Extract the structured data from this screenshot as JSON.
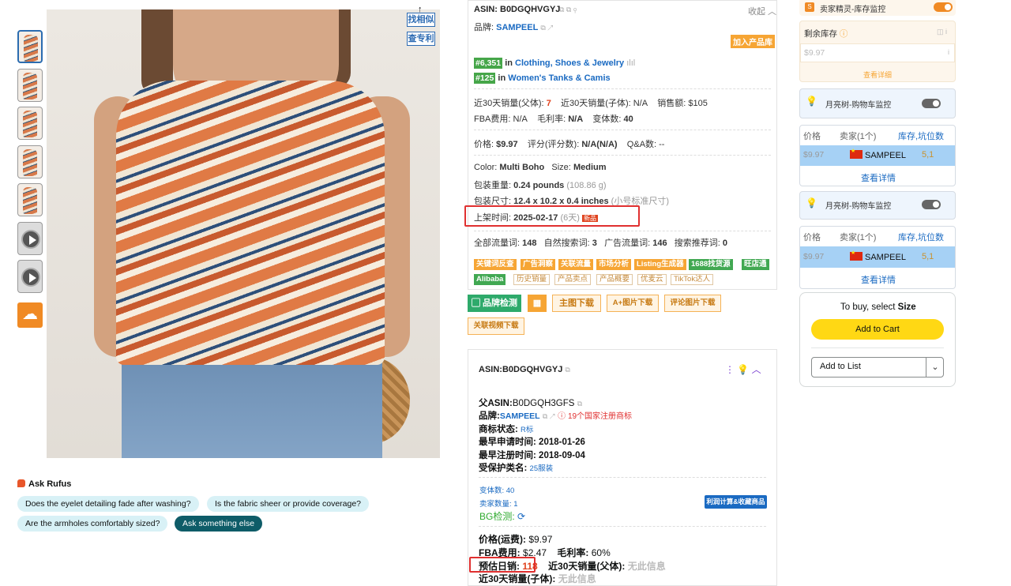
{
  "left": {
    "find_similar": "找相似",
    "check_patent": "查专利",
    "rufus": {
      "title": "Ask Rufus",
      "chips": [
        "Does the eyelet detailing fade after washing?",
        "Is the fabric sheer or provide coverage?",
        "Are the armholes comfortably sized?",
        "Ask something else"
      ]
    }
  },
  "info": {
    "asin": "ASIN: B0DGQHVGYJ",
    "collapse": "收起",
    "brand_label": "品牌:",
    "brand": "SAMPEEL",
    "add_library": "加入产品库",
    "rank1": "#6,351",
    "rank1_in": "in",
    "rank1_cat": "Clothing, Shoes & Jewelry",
    "rank2": "#125",
    "rank2_in": "in",
    "rank2_cat": "Women's Tanks & Camis",
    "sales30_parent_label": "近30天销量(父体):",
    "sales30_parent": "7",
    "sales30_child": "近30天销量(子体): N/A",
    "revenue": "销售额: $105",
    "fba": "FBA费用:",
    "fba_val": "N/A",
    "margin": "毛利率:",
    "margin_val": "N/A",
    "variants": "变体数:",
    "variants_val": "40",
    "price_label": "价格:",
    "price_val": "$9.97",
    "rating_label": "评分(评分数):",
    "rating_val": "N/A(N/A)",
    "qa": "Q&A数: --",
    "color_label": "Color:",
    "color_val": "Multi Boho",
    "size_label": "Size:",
    "size_val": "Medium",
    "weight_label": "包装重量:",
    "weight_val": "0.24 pounds",
    "weight_g": "(108.86 g)",
    "dims_label": "包装尺寸:",
    "dims_val": "12.4 x 10.2 x 0.4 inches",
    "dims_note": "(小号标准尺寸)",
    "listed_label": "上架时间:",
    "listed_val": "2025-02-17",
    "listed_days": "(6天)",
    "new_badge": "新品",
    "kw_all": "全部流量词:",
    "kw_all_val": "148",
    "kw_natural": "自然搜索词:",
    "kw_natural_val": "3",
    "kw_ad": "广告流量词:",
    "kw_ad_val": "146",
    "kw_rec": "搜索推荐词:",
    "kw_rec_val": "0",
    "tags_row1": [
      "关键词反查",
      "广告洞察",
      "关联流量",
      "市场分析",
      "Listing生成器",
      "1688找货源",
      "旺店通"
    ],
    "tags_row2": [
      "Alibaba",
      "历史销量",
      "产品卖点",
      "产品概要",
      "优麦云",
      "TikTok达人"
    ]
  },
  "actions": {
    "brand_check": "品牌检测",
    "main_download": "主图下载",
    "aplus_download": "A+图片下载",
    "review_img_download": "评论图片下载",
    "related_video_download": "关联视频下载"
  },
  "card2": {
    "asin": "ASIN:B0DGQHVGYJ",
    "parent_label": "父ASIN:",
    "parent_val": "B0DGQH3GFS",
    "brand_label": "品牌:",
    "brand_val": "SAMPEEL",
    "tm_warning": "19个国家注册商标",
    "tm_status_label": "商标状态:",
    "tm_status_val": "R标",
    "earliest_apply_label": "最早申请时间:",
    "earliest_apply_val": "2018-01-26",
    "earliest_reg_label": "最早注册时间:",
    "earliest_reg_val": "2018-09-04",
    "class_label": "受保护类名:",
    "class_val": "25服装",
    "variants": "变体数: 40",
    "sellers": "卖家数量: 1",
    "profit_btn": "利润计算&收藏商品",
    "bg_check": "BG检测:",
    "price_label": "价格(运费):",
    "price_val": "$9.97",
    "fba_label": "FBA费用:",
    "fba_val": "$2.47",
    "margin_label": "毛利率:",
    "margin_val": "60%",
    "daily_label": "预估日销:",
    "daily_val": "118",
    "parent30_label": "近30天销量(父体):",
    "parent30_val": "无此信息",
    "child30_label": "近30天销量(子体):",
    "child30_val": "无此信息"
  },
  "right": {
    "seller_sprite": "卖家精灵-库存监控",
    "stock_label": "剩余库存",
    "stock_price": "$9.97",
    "view_detail": "查看详细",
    "monitor1": "月亮树-购物车监控",
    "table_headers": [
      "价格",
      "卖家(1个)",
      "库存,坑位数"
    ],
    "row_price": "$9.97",
    "row_seller": "SAMPEEL",
    "row_stock": "5,1",
    "view_detail2": "查看详情",
    "monitor2": "月亮树-购物车监控",
    "view_detail3": "查看详情",
    "to_buy_prefix": "To buy, select",
    "to_buy_bold": "Size",
    "add_to_cart": "Add to Cart",
    "add_to_list": "Add to List"
  },
  "colors": {
    "link_blue": "#1a6ac2",
    "accent_orange": "#f6a534",
    "green": "#46a649",
    "highlight_red": "#e03030",
    "cart_yellow": "#ffd814"
  }
}
